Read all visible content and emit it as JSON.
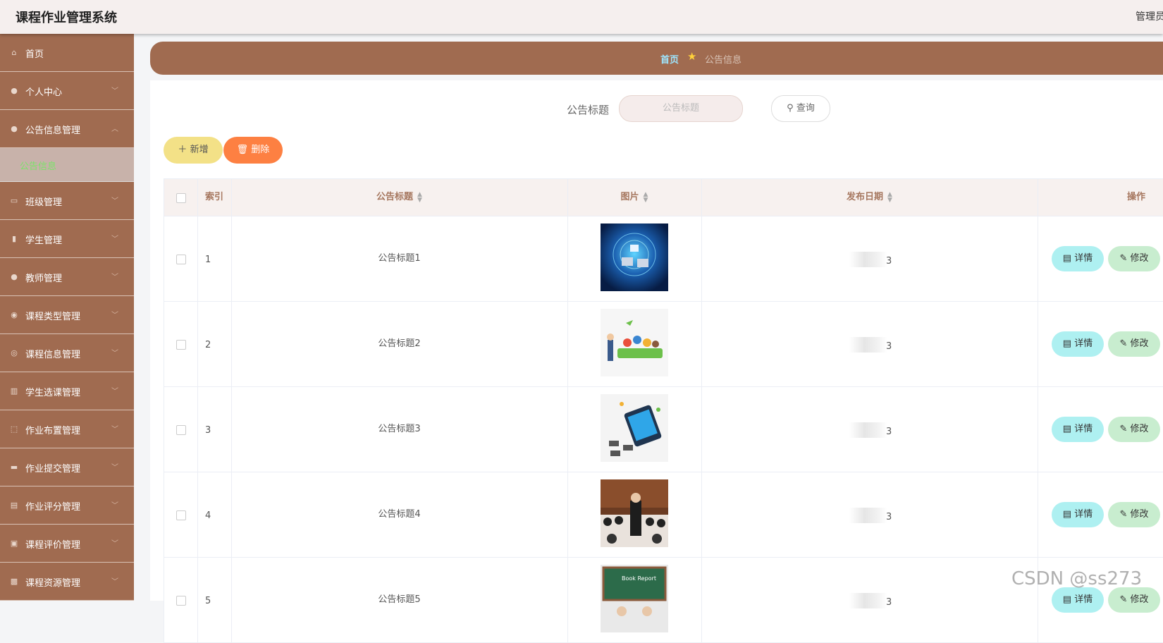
{
  "app": {
    "title": "课程作业管理系统",
    "user": "管理员"
  },
  "sidebar": {
    "items": [
      {
        "label": "首页",
        "icon": "home-icon"
      },
      {
        "label": "个人中心",
        "icon": "user-icon"
      },
      {
        "label": "公告信息管理",
        "icon": "user-icon"
      },
      {
        "label": "班级管理",
        "icon": "chat-icon"
      },
      {
        "label": "学生管理",
        "icon": "chart-icon"
      },
      {
        "label": "教师管理",
        "icon": "user-icon"
      },
      {
        "label": "课程类型管理",
        "icon": "location-icon"
      },
      {
        "label": "课程信息管理",
        "icon": "compass-icon"
      },
      {
        "label": "学生选课管理",
        "icon": "bar-chart-icon"
      },
      {
        "label": "作业布置管理",
        "icon": "frame-icon"
      },
      {
        "label": "作业提交管理",
        "icon": "ticket-icon"
      },
      {
        "label": "作业评分管理",
        "icon": "card-icon"
      },
      {
        "label": "课程评价管理",
        "icon": "clipboard-icon"
      },
      {
        "label": "课程资源管理",
        "icon": "box-icon"
      }
    ],
    "sub_active": "公告信息"
  },
  "breadcrumb": {
    "home": "首页",
    "current": "公告信息"
  },
  "search": {
    "label": "公告标题",
    "placeholder": "公告标题",
    "button": "查询"
  },
  "actions": {
    "add": "新增",
    "delete": "删除"
  },
  "table": {
    "columns": {
      "index": "索引",
      "title": "公告标题",
      "image": "图片",
      "date": "发布日期",
      "ops": "操作"
    },
    "rows": [
      {
        "index": "1",
        "title": "公告标题1",
        "date": "3"
      },
      {
        "index": "2",
        "title": "公告标题2",
        "date": "3"
      },
      {
        "index": "3",
        "title": "公告标题3",
        "date": "3"
      },
      {
        "index": "4",
        "title": "公告标题4",
        "date": "3"
      },
      {
        "index": "5",
        "title": "公告标题5",
        "date": "3"
      }
    ],
    "row_actions": {
      "detail": "详情",
      "edit": "修改"
    }
  },
  "watermark": "CSDN @ss273"
}
